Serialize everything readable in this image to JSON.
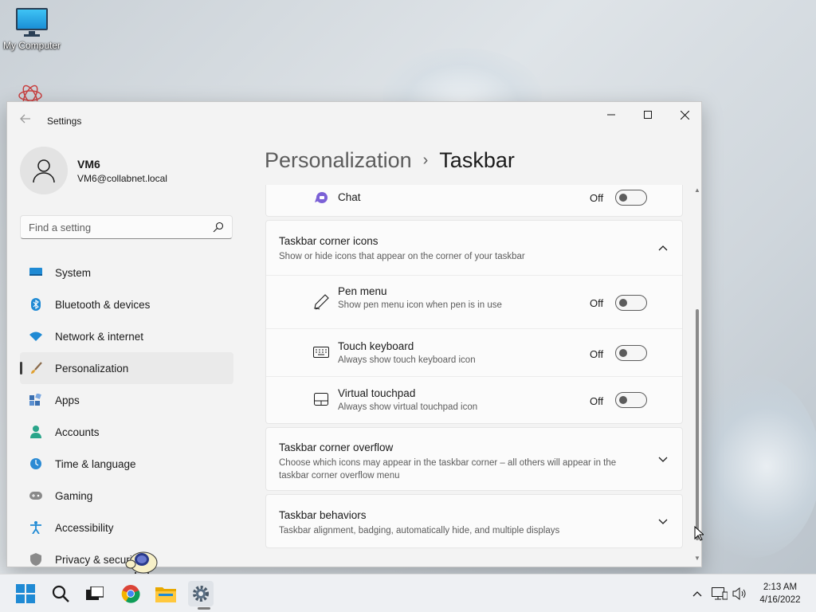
{
  "desktop": {
    "icons": [
      {
        "label": "My Computer"
      }
    ]
  },
  "window": {
    "title": "Settings",
    "controls": {
      "minimize": "—",
      "maximize": "☐",
      "close": "✕"
    }
  },
  "profile": {
    "name": "VM6",
    "email": "VM6@collabnet.local"
  },
  "search": {
    "placeholder": "Find a setting"
  },
  "nav": {
    "items": [
      {
        "label": "System",
        "icon": "system-icon"
      },
      {
        "label": "Bluetooth & devices",
        "icon": "bluetooth-icon"
      },
      {
        "label": "Network & internet",
        "icon": "network-icon"
      },
      {
        "label": "Personalization",
        "icon": "brush-icon",
        "active": true
      },
      {
        "label": "Apps",
        "icon": "apps-icon"
      },
      {
        "label": "Accounts",
        "icon": "accounts-icon"
      },
      {
        "label": "Time & language",
        "icon": "time-icon"
      },
      {
        "label": "Gaming",
        "icon": "gaming-icon"
      },
      {
        "label": "Accessibility",
        "icon": "accessibility-icon"
      },
      {
        "label": "Privacy & security",
        "icon": "shield-icon"
      }
    ]
  },
  "breadcrumb": {
    "parent": "Personalization",
    "separator": "›",
    "current": "Taskbar"
  },
  "settings": {
    "chat": {
      "title": "Chat",
      "state": "Off"
    },
    "corner_icons": {
      "title": "Taskbar corner icons",
      "desc": "Show or hide icons that appear on the corner of your taskbar",
      "items": [
        {
          "title": "Pen menu",
          "desc": "Show pen menu icon when pen is in use",
          "state": "Off",
          "icon": "pen-icon"
        },
        {
          "title": "Touch keyboard",
          "desc": "Always show touch keyboard icon",
          "state": "Off",
          "icon": "keyboard-icon"
        },
        {
          "title": "Virtual touchpad",
          "desc": "Always show virtual touchpad icon",
          "state": "Off",
          "icon": "touchpad-icon"
        }
      ]
    },
    "corner_overflow": {
      "title": "Taskbar corner overflow",
      "desc": "Choose which icons may appear in the taskbar corner – all others will appear in the taskbar corner overflow menu"
    },
    "behaviors": {
      "title": "Taskbar behaviors",
      "desc": "Taskbar alignment, badging, automatically hide, and multiple displays"
    }
  },
  "taskbar": {
    "apps": [
      "start-icon",
      "search-icon",
      "task-view-icon",
      "chrome-icon",
      "file-explorer-icon",
      "settings-icon"
    ],
    "clock": {
      "time": "2:13 AM",
      "date": "4/16/2022"
    }
  },
  "colors": {
    "accent": "#0067c0",
    "chat_icon": "#7b61d6",
    "window_bg": "#f3f3f3",
    "card_bg": "#fbfbfb"
  }
}
